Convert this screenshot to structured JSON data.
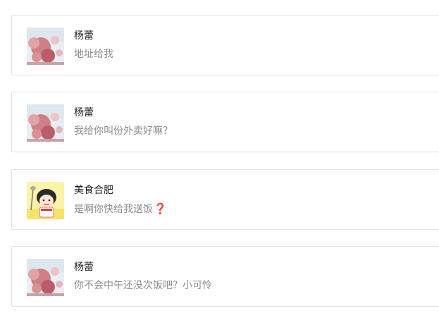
{
  "messages": [
    {
      "sender": "杨蕾",
      "text": "地址给我",
      "avatar": "cherry-blossom-avatar"
    },
    {
      "sender": "杨蕾",
      "text": "我给你叫份外卖好嘛？",
      "avatar": "cherry-blossom-avatar"
    },
    {
      "sender": "美食合肥",
      "text": "是啊你快给我送饭",
      "emoji": "❓",
      "avatar": "cartoon-girl-avatar"
    },
    {
      "sender": "杨蕾",
      "text": "你不会中午还没次饭吧？小可怜",
      "avatar": "cherry-blossom-avatar"
    }
  ],
  "colors": {
    "border": "#e2e2e2",
    "name": "#222222",
    "message": "#8c8c8c",
    "emoji": "#d0202a"
  }
}
